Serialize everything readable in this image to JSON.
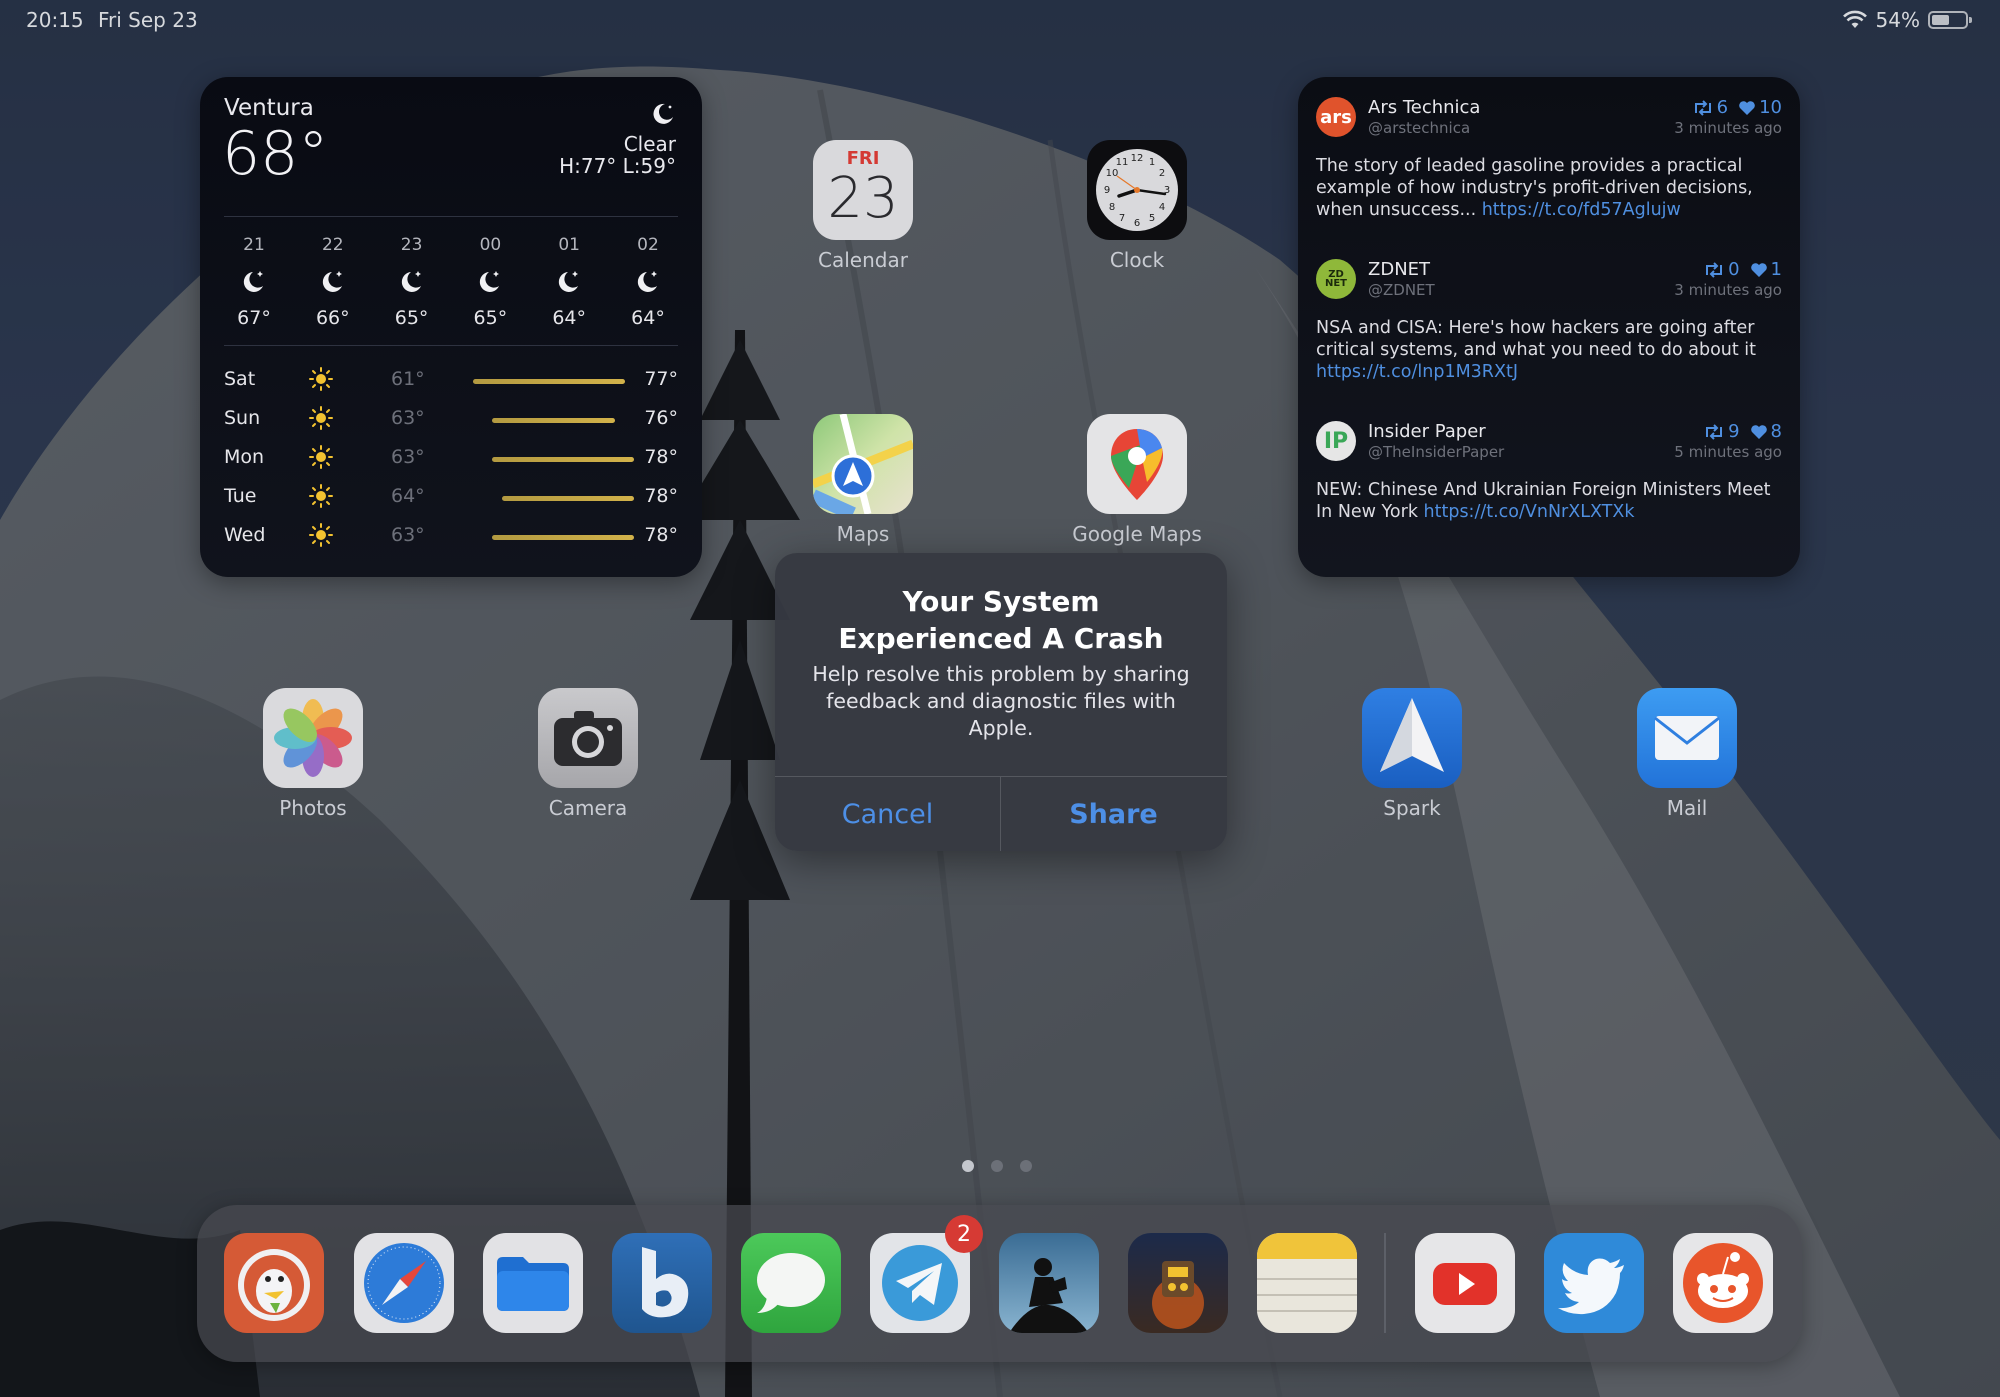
{
  "status_bar": {
    "time": "20:15",
    "date": "Fri Sep 23",
    "battery": "54%",
    "battery_level": 0.54
  },
  "weather": {
    "location": "Ventura",
    "temperature": "68°",
    "condition": "Clear",
    "high_low": "H:77° L:59°",
    "icon": "moon-icon",
    "hourly": [
      {
        "hour": "21",
        "temp": "67°",
        "icon": "moon-stars-icon"
      },
      {
        "hour": "22",
        "temp": "66°",
        "icon": "moon-stars-icon"
      },
      {
        "hour": "23",
        "temp": "65°",
        "icon": "moon-stars-icon"
      },
      {
        "hour": "00",
        "temp": "65°",
        "icon": "moon-stars-icon"
      },
      {
        "hour": "01",
        "temp": "64°",
        "icon": "moon-stars-icon"
      },
      {
        "hour": "02",
        "temp": "64°",
        "icon": "moon-stars-icon"
      }
    ],
    "daily": [
      {
        "day": "Sat",
        "low": "61°",
        "high": "77°",
        "low_value": 61,
        "high_value": 77,
        "icon": "sun-icon"
      },
      {
        "day": "Sun",
        "low": "63°",
        "high": "76°",
        "low_value": 63,
        "high_value": 76,
        "icon": "sun-icon"
      },
      {
        "day": "Mon",
        "low": "63°",
        "high": "78°",
        "low_value": 63,
        "high_value": 78,
        "icon": "sun-icon"
      },
      {
        "day": "Tue",
        "low": "64°",
        "high": "78°",
        "low_value": 64,
        "high_value": 78,
        "icon": "sun-icon"
      },
      {
        "day": "Wed",
        "low": "63°",
        "high": "78°",
        "low_value": 63,
        "high_value": 78,
        "icon": "sun-icon"
      }
    ],
    "colors": {
      "bar": "#c9aa45"
    }
  },
  "apps": {
    "calendar": {
      "label": "Calendar",
      "weekday": "FRI",
      "day": "23"
    },
    "clock": {
      "label": "Clock",
      "numerals": [
        "12",
        "1",
        "2",
        "3",
        "4",
        "5",
        "6",
        "7",
        "8",
        "9",
        "10",
        "11"
      ]
    },
    "maps": {
      "label": "Maps"
    },
    "google_maps": {
      "label": "Google Maps"
    },
    "photos": {
      "label": "Photos"
    },
    "camera": {
      "label": "Camera"
    },
    "spark": {
      "label": "Spark"
    },
    "mail": {
      "label": "Mail"
    }
  },
  "twitter": {
    "tweets": [
      {
        "avatar_text": "ars",
        "avatar_color": "#e0532c",
        "name": "Ars Technica",
        "handle": "@arstechnica",
        "retweets": "6",
        "likes": "10",
        "time": "3 minutes ago",
        "text": "The story of leaded gasoline provides a practical example of how industry's profit-driven decisions, when unsuccess... ",
        "link": "https://t.co/fd57Aglujw"
      },
      {
        "avatar_text": "ZD NET",
        "avatar_color": "#8fb83a",
        "name": "ZDNET",
        "handle": "@ZDNET",
        "retweets": "0",
        "likes": "1",
        "time": "3 minutes ago",
        "text": "NSA and CISA: Here's how hackers are going after critical systems, and what you need to do about it ",
        "link": "https://t.co/lnp1M3RXtJ"
      },
      {
        "avatar_text": "IP",
        "avatar_color": "#e6e6e6",
        "name": "Insider Paper",
        "handle": "@TheInsiderPaper",
        "retweets": "9",
        "likes": "8",
        "time": "5 minutes ago",
        "text": "NEW: Chinese And Ukrainian Foreign Ministers Meet In New York ",
        "link": "https://t.co/VnNrXLXTXk"
      }
    ]
  },
  "alert": {
    "title": "Your System Experienced A Crash",
    "message": "Help resolve this problem by sharing feedback and diagnostic files with Apple.",
    "cancel_label": "Cancel",
    "share_label": "Share",
    "button_color": "#4d8fe6"
  },
  "pages": {
    "count": 3,
    "active": 0
  },
  "dock": {
    "apps": [
      {
        "name": "duckduckgo",
        "icon": "duckduckgo-icon"
      },
      {
        "name": "safari",
        "icon": "safari-compass-icon"
      },
      {
        "name": "files",
        "icon": "folder-icon"
      },
      {
        "name": "bing",
        "icon": "bing-b-icon"
      },
      {
        "name": "messages",
        "icon": "message-bubble-icon"
      },
      {
        "name": "telegram",
        "icon": "paper-plane-icon",
        "badge": "2"
      },
      {
        "name": "kindle",
        "icon": "reader-icon"
      },
      {
        "name": "game",
        "icon": "game-icon"
      },
      {
        "name": "notes",
        "icon": "notes-icon"
      },
      {
        "name": "youtube",
        "icon": "play-icon"
      },
      {
        "name": "twitter",
        "icon": "bird-icon"
      },
      {
        "name": "reddit",
        "icon": "reddit-alien-icon"
      }
    ]
  }
}
